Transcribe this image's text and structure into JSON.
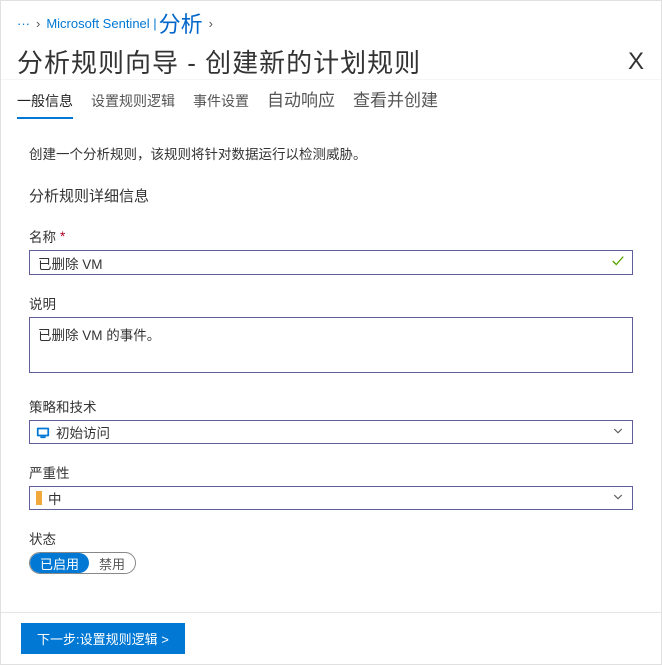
{
  "breadcrumb": {
    "ellipsis": "···",
    "item1": "Microsoft Sentinel |",
    "item2": "分析"
  },
  "page": {
    "title": "分析规则向导 - 创建新的计划规则",
    "close": "X"
  },
  "tabs": {
    "general": "一般信息",
    "logic": "设置规则逻辑",
    "incident": "事件设置",
    "auto": "自动响应",
    "review": "查看并创建"
  },
  "intro": "创建一个分析规则，该规则将针对数据运行以检测威胁。",
  "section_detail": "分析规则详细信息",
  "fields": {
    "name_label": "名称",
    "name_value": "已删除 VM",
    "desc_label": "说明",
    "desc_value": "已删除 VM 的事件。",
    "tactics_label": "策略和技术",
    "tactics_value": "初始访问",
    "severity_label": "严重性",
    "severity_value": "中",
    "status_label": "状态",
    "status_enabled": "已启用",
    "status_disabled": "禁用"
  },
  "footer": {
    "next": "下一步:设置规则逻辑  >"
  }
}
